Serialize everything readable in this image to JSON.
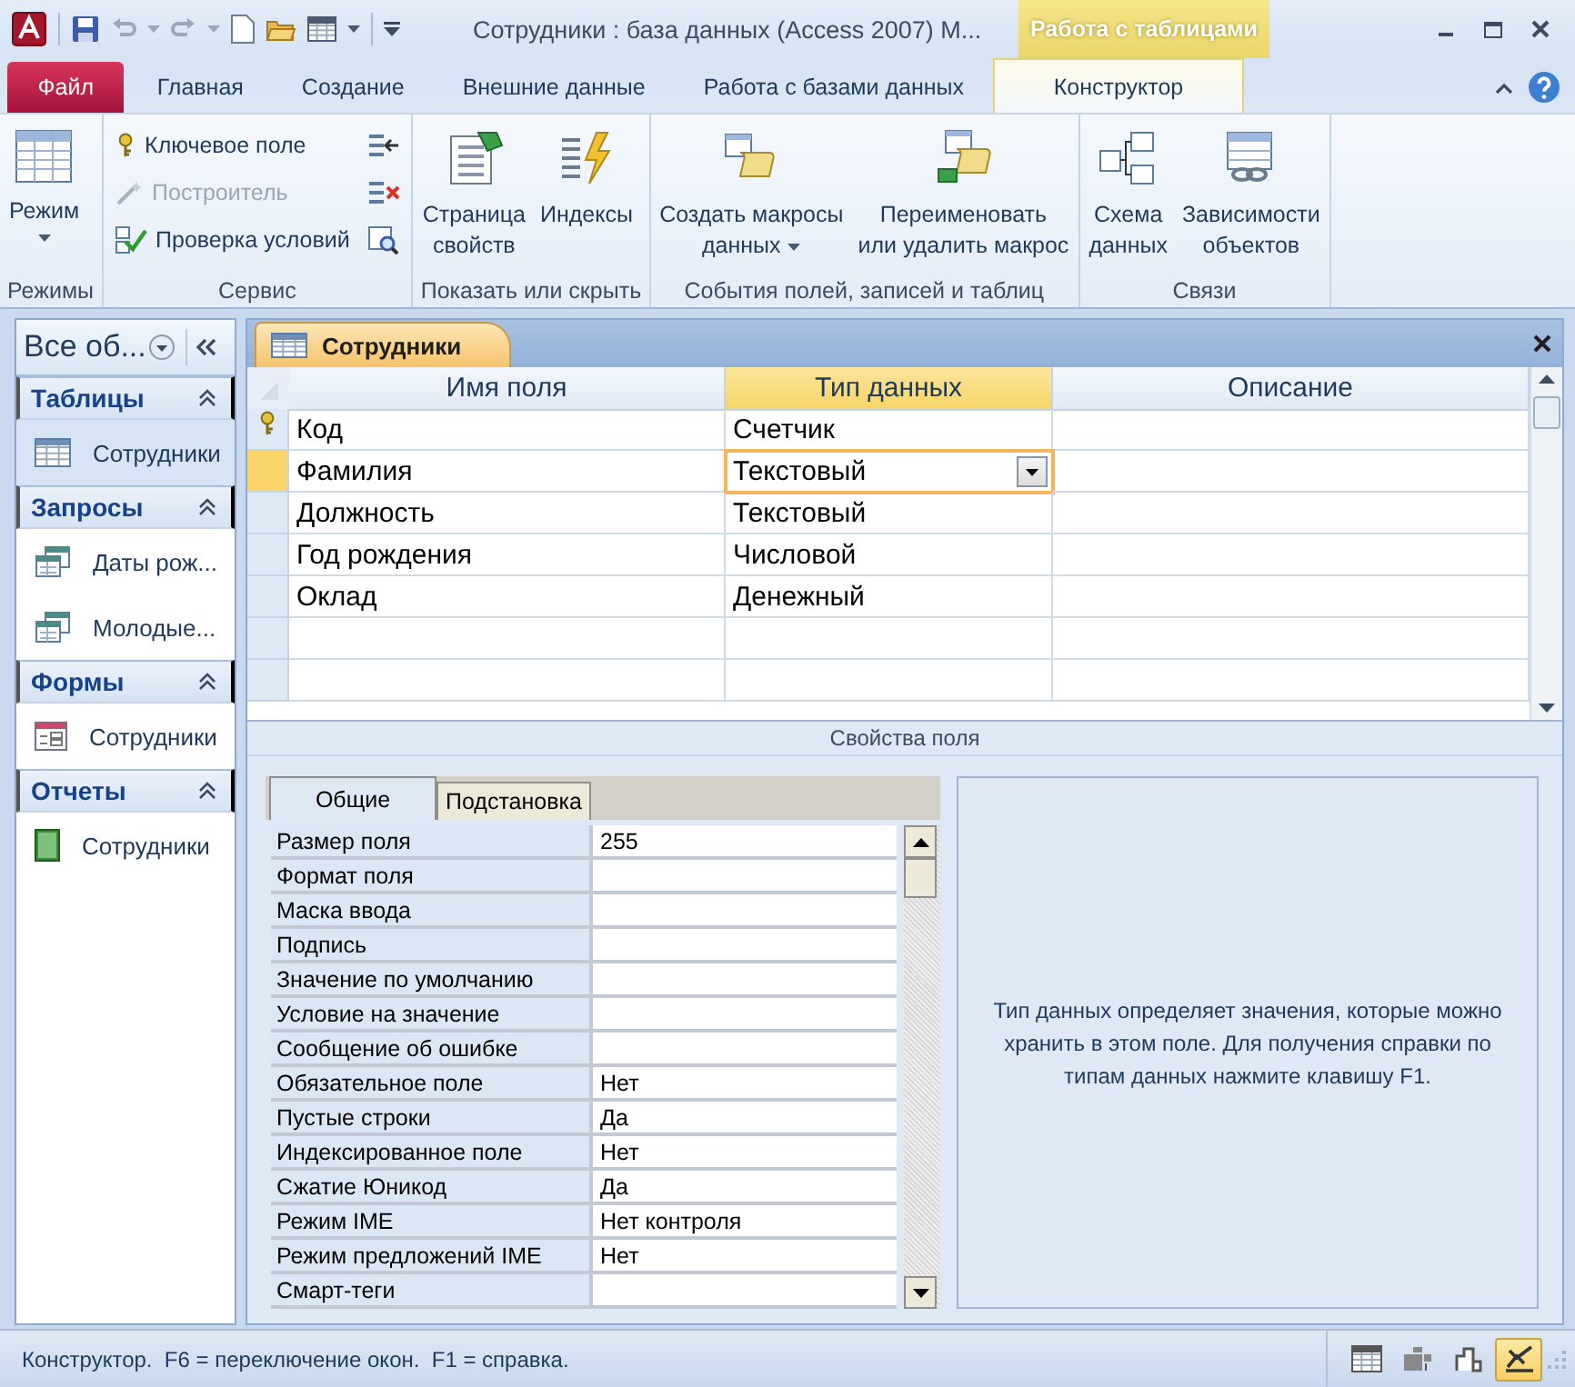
{
  "title_bar": {
    "title": "Сотрудники : база данных (Access 2007) M...",
    "context_tab": "Работа с таблицами"
  },
  "ribbon": {
    "tabs": [
      {
        "label": "Файл",
        "kind": "file",
        "selected": false
      },
      {
        "label": "Главная",
        "kind": "tab",
        "selected": false
      },
      {
        "label": "Создание",
        "kind": "tab",
        "selected": false
      },
      {
        "label": "Внешние данные",
        "kind": "tab",
        "selected": false
      },
      {
        "label": "Работа с базами данных",
        "kind": "tab",
        "selected": false
      },
      {
        "label": "Конструктор",
        "kind": "context",
        "selected": true
      }
    ],
    "groups": [
      {
        "label": "Режимы",
        "buttons": [
          {
            "kind": "large",
            "label": "Режим",
            "dropdown": true
          }
        ]
      },
      {
        "label": "Сервис",
        "buttons": [
          {
            "kind": "small",
            "label": "Ключевое поле",
            "disabled": false
          },
          {
            "kind": "small",
            "label": "Построитель",
            "disabled": true
          },
          {
            "kind": "small",
            "label": "Проверка условий",
            "disabled": false
          },
          {
            "kind": "icon",
            "disabled": false
          },
          {
            "kind": "icon",
            "disabled": false
          },
          {
            "kind": "icon",
            "disabled": false
          }
        ]
      },
      {
        "label": "Показать или скрыть",
        "buttons": [
          {
            "kind": "large",
            "label": "Страница\nсвойств",
            "dropdown": false
          },
          {
            "kind": "large",
            "label": "Индексы",
            "dropdown": false
          }
        ]
      },
      {
        "label": "События полей, записей и таблиц",
        "buttons": [
          {
            "kind": "large",
            "label": "Создать макросы\nданных",
            "dropdown": true
          },
          {
            "kind": "large",
            "label": "Переименовать\nили удалить макрос",
            "dropdown": false
          }
        ]
      },
      {
        "label": "Связи",
        "buttons": [
          {
            "kind": "large",
            "label": "Схема\nданных",
            "dropdown": false
          },
          {
            "kind": "large",
            "label": "Зависимости\nобъектов",
            "dropdown": false
          }
        ]
      }
    ]
  },
  "navigation": {
    "header": "Все об...",
    "groups": [
      {
        "label": "Таблицы",
        "items": [
          {
            "kind": "table",
            "label": "Сотрудники",
            "selected": true
          }
        ]
      },
      {
        "label": "Запросы",
        "items": [
          {
            "kind": "query",
            "label": "Даты рож...",
            "selected": false
          },
          {
            "kind": "query",
            "label": "Молодые...",
            "selected": false
          }
        ]
      },
      {
        "label": "Формы",
        "items": [
          {
            "kind": "form",
            "label": "Сотрудники",
            "selected": false
          }
        ]
      },
      {
        "label": "Отчеты",
        "items": [
          {
            "kind": "report",
            "label": "Сотрудники",
            "selected": false
          }
        ]
      }
    ]
  },
  "document": {
    "tab": "Сотрудники",
    "columns": [
      {
        "label": "Имя поля",
        "selected": false
      },
      {
        "label": "Тип данных",
        "selected": true
      },
      {
        "label": "Описание",
        "selected": false
      }
    ],
    "rows": [
      {
        "name": "Код",
        "type": "Счетчик",
        "primary_key": true,
        "selected": false
      },
      {
        "name": "Фамилия",
        "type": "Текстовый",
        "primary_key": false,
        "selected": true
      },
      {
        "name": "Должность",
        "type": "Текстовый",
        "primary_key": false,
        "selected": false
      },
      {
        "name": "Год рождения",
        "type": "Числовой",
        "primary_key": false,
        "selected": false
      },
      {
        "name": "Оклад",
        "type": "Денежный",
        "primary_key": false,
        "selected": false
      }
    ],
    "properties_title": "Свойства поля",
    "property_tabs": [
      {
        "label": "Общие",
        "selected": true
      },
      {
        "label": "Подстановка",
        "selected": false
      }
    ],
    "properties": [
      {
        "name": "Размер поля",
        "value": "255"
      },
      {
        "name": "Формат поля"
      },
      {
        "name": "Маска ввода"
      },
      {
        "name": "Подпись"
      },
      {
        "name": "Значение по умолчанию"
      },
      {
        "name": "Условие на значение"
      },
      {
        "name": "Сообщение об ошибке"
      },
      {
        "name": "Обязательное поле",
        "value": "Нет"
      },
      {
        "name": "Пустые строки",
        "value": "Да"
      },
      {
        "name": "Индексированное поле",
        "value": "Нет"
      },
      {
        "name": "Сжатие Юникод",
        "value": "Да"
      },
      {
        "name": "Режим IME",
        "value": "Нет контроля"
      },
      {
        "name": "Режим предложений IME",
        "value": "Нет"
      },
      {
        "name": "Смарт-теги"
      }
    ],
    "help": "Тип данных определяет значения, которые можно хранить в этом поле. Для получения справки по типам данных нажмите клавишу F1."
  },
  "status_bar": {
    "text": "Конструктор.  F6 = переключение окон.  F1 = справка.",
    "views": [
      {
        "kind": "datasheet",
        "selected": false
      },
      {
        "kind": "pivot-table",
        "selected": false
      },
      {
        "kind": "pivot-chart",
        "selected": false
      },
      {
        "kind": "design",
        "selected": true
      }
    ]
  }
}
